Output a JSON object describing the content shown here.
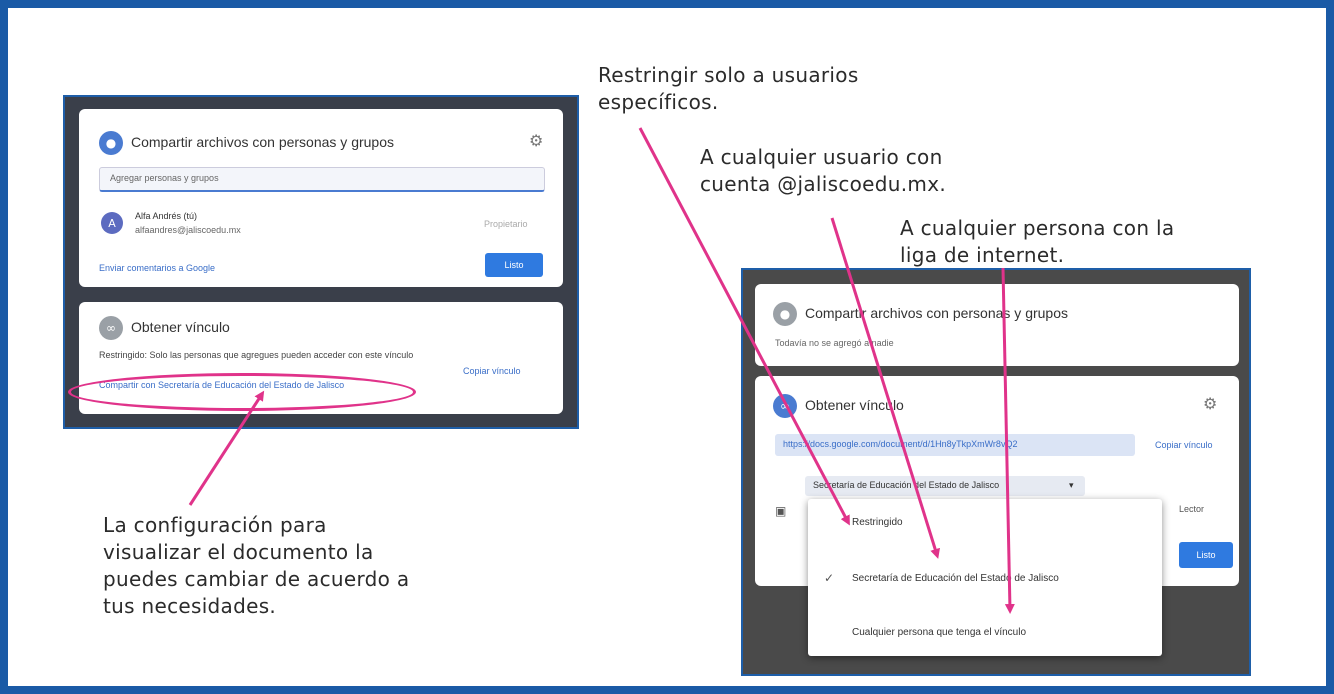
{
  "captions": {
    "restrict": [
      "Restringir solo a usuarios",
      "específicos."
    ],
    "domain": [
      "A cualquier usuario con",
      "cuenta @jaliscoedu.mx."
    ],
    "anyone": [
      "A cualquier persona con la",
      "liga de internet."
    ],
    "config": [
      "La configuración para",
      "visualizar el documento la",
      "puedes cambiar de acuerdo a",
      "tus necesidades."
    ]
  },
  "left_dialog": {
    "share_title": "Compartir archivos con personas y grupos",
    "add_placeholder": "Agregar personas y grupos",
    "owner_name": "Alfa Andrés (tú)",
    "owner_email": "alfaandres@jaliscoedu.mx",
    "owner_role": "Propietario",
    "owner_initial": "A",
    "feedback_link": "Enviar comentarios a Google",
    "done_button": "Listo",
    "link_title": "Obtener vínculo",
    "restricted_line": "Restringido: Solo las personas que agregues pueden acceder con este vínculo",
    "change_link": "Compartir con Secretaría de Educación del Estado de Jalisco",
    "copy_link": "Copiar vínculo"
  },
  "right_dialog": {
    "share_title": "Compartir archivos con personas y grupos",
    "share_sub": "Todavía no se agregó a nadie",
    "link_title": "Obtener vínculo",
    "link_url": "https://docs.google.com/document/d/1Hn8yTkpXmWr8vQ2",
    "copy_link": "Copiar vínculo",
    "scope_chip": "Secretaría de Educación del Estado de Jalisco",
    "role_select": "Lector",
    "done_button": "Listo",
    "options": {
      "restricted": "Restringido",
      "domain": "Secretaría de Educación del Estado de Jalisco",
      "anyone": "Cualquier persona que tenga el vínculo"
    }
  },
  "colors": {
    "frame": "#1a5aa6",
    "accent": "#2f7ae0",
    "arrow": "#e0338a"
  }
}
